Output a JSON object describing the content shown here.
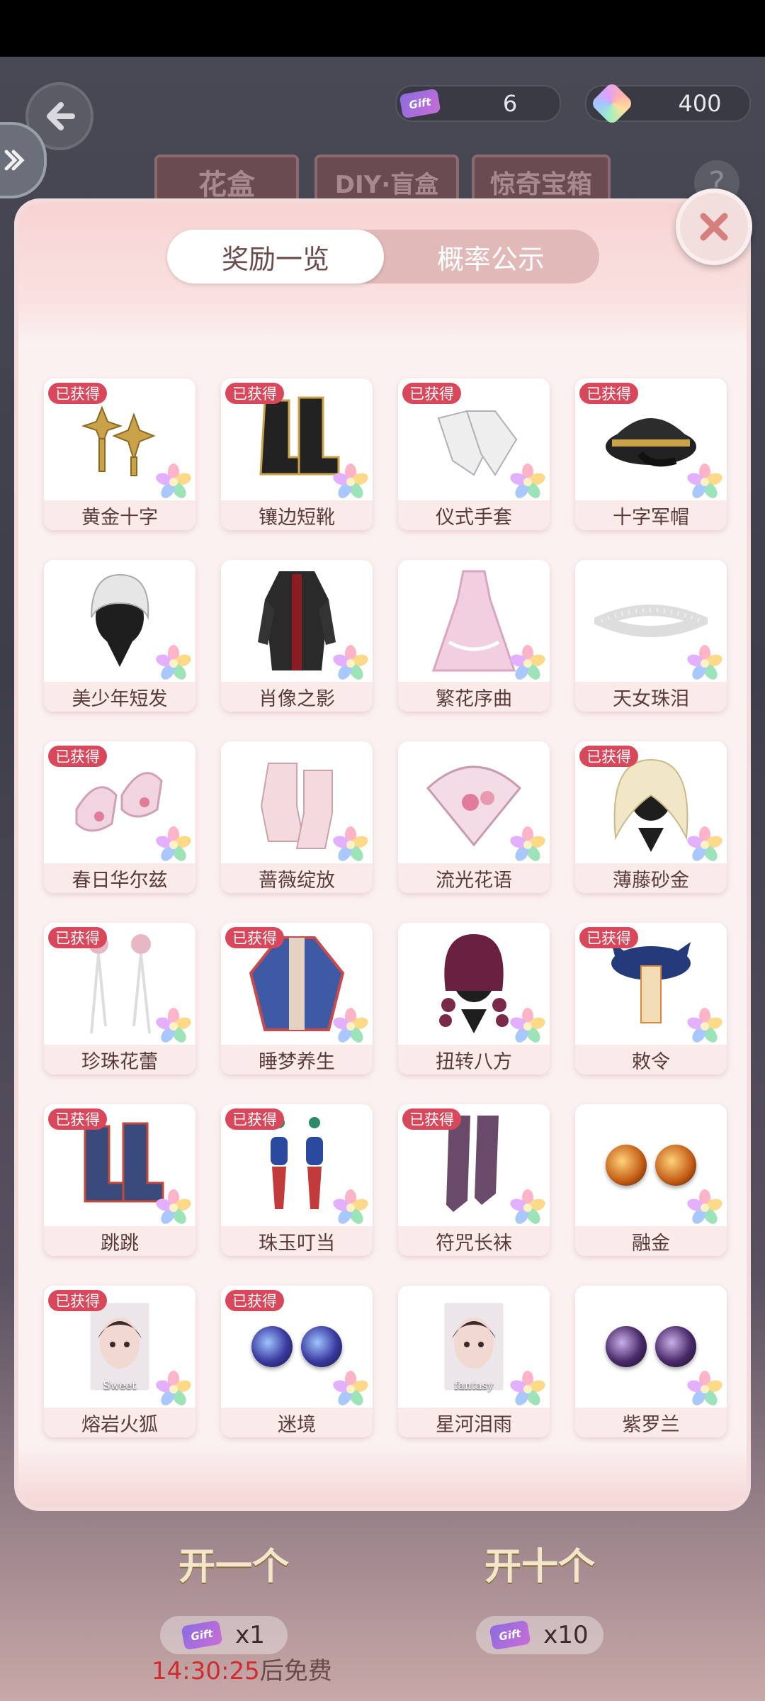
{
  "currencies": [
    {
      "icon": "ticket-icon",
      "ticket_text": "Gift",
      "value": "6"
    },
    {
      "icon": "gem-icon",
      "value": "400"
    }
  ],
  "top_tabs": [
    "花盒",
    "DIY·盲盒",
    "惊奇宝箱"
  ],
  "help_label": "?",
  "modal": {
    "tabs": [
      {
        "label": "奖励一览",
        "active": true
      },
      {
        "label": "概率公示",
        "active": false
      }
    ],
    "obtained_badge": "已获得",
    "items": [
      {
        "name": "黄金十字",
        "obtained": true,
        "icon": "gold-cross-earrings-icon"
      },
      {
        "name": "镶边短靴",
        "obtained": true,
        "icon": "boots-icon"
      },
      {
        "name": "仪式手套",
        "obtained": true,
        "icon": "white-gloves-icon"
      },
      {
        "name": "十字军帽",
        "obtained": true,
        "icon": "military-cap-icon"
      },
      {
        "name": "美少年短发",
        "obtained": false,
        "icon": "short-hair-icon"
      },
      {
        "name": "肖像之影",
        "obtained": false,
        "icon": "dark-coat-icon"
      },
      {
        "name": "繁花序曲",
        "obtained": false,
        "icon": "pink-dress-icon"
      },
      {
        "name": "天女珠泪",
        "obtained": false,
        "icon": "pearl-headband-icon"
      },
      {
        "name": "春日华尔兹",
        "obtained": true,
        "icon": "pink-shoes-icon"
      },
      {
        "name": "蔷薇绽放",
        "obtained": false,
        "icon": "lace-gloves-icon"
      },
      {
        "name": "流光花语",
        "obtained": false,
        "icon": "shell-fan-icon"
      },
      {
        "name": "薄藤砂金",
        "obtained": true,
        "icon": "blonde-hair-icon"
      },
      {
        "name": "珍珠花蕾",
        "obtained": true,
        "icon": "pearl-earrings-icon"
      },
      {
        "name": "睡梦养生",
        "obtained": true,
        "icon": "blue-robe-icon"
      },
      {
        "name": "扭转八方",
        "obtained": false,
        "icon": "braided-hair-icon"
      },
      {
        "name": "敕令",
        "obtained": true,
        "icon": "talisman-hat-icon"
      },
      {
        "name": "跳跳",
        "obtained": true,
        "icon": "blue-boots-icon"
      },
      {
        "name": "珠玉叮当",
        "obtained": true,
        "icon": "tassel-earrings-icon"
      },
      {
        "name": "符咒长袜",
        "obtained": true,
        "icon": "stockings-icon"
      },
      {
        "name": "融金",
        "obtained": false,
        "icon": "golden-eyes-icon"
      },
      {
        "name": "熔岩火狐",
        "obtained": true,
        "icon": "makeup-card-icon",
        "card_text": "Sweet"
      },
      {
        "name": "迷境",
        "obtained": true,
        "icon": "blue-eyes-icon"
      },
      {
        "name": "星河泪雨",
        "obtained": false,
        "icon": "makeup-card-icon",
        "card_text": "fantasy"
      },
      {
        "name": "紫罗兰",
        "obtained": false,
        "icon": "violet-eyes-icon"
      }
    ]
  },
  "actions": [
    {
      "label": "开一个",
      "cost": "x1",
      "ticket_text": "Gift"
    },
    {
      "label": "开十个",
      "cost": "x10",
      "ticket_text": "Gift"
    }
  ],
  "timer": {
    "time": "14:30:25",
    "suffix": "后免费"
  },
  "colors": {
    "badge": "#d9475a",
    "timer": "#d12b2b",
    "modal_bg": "#fbf1f1",
    "tab_track": "#e2b9b9"
  }
}
